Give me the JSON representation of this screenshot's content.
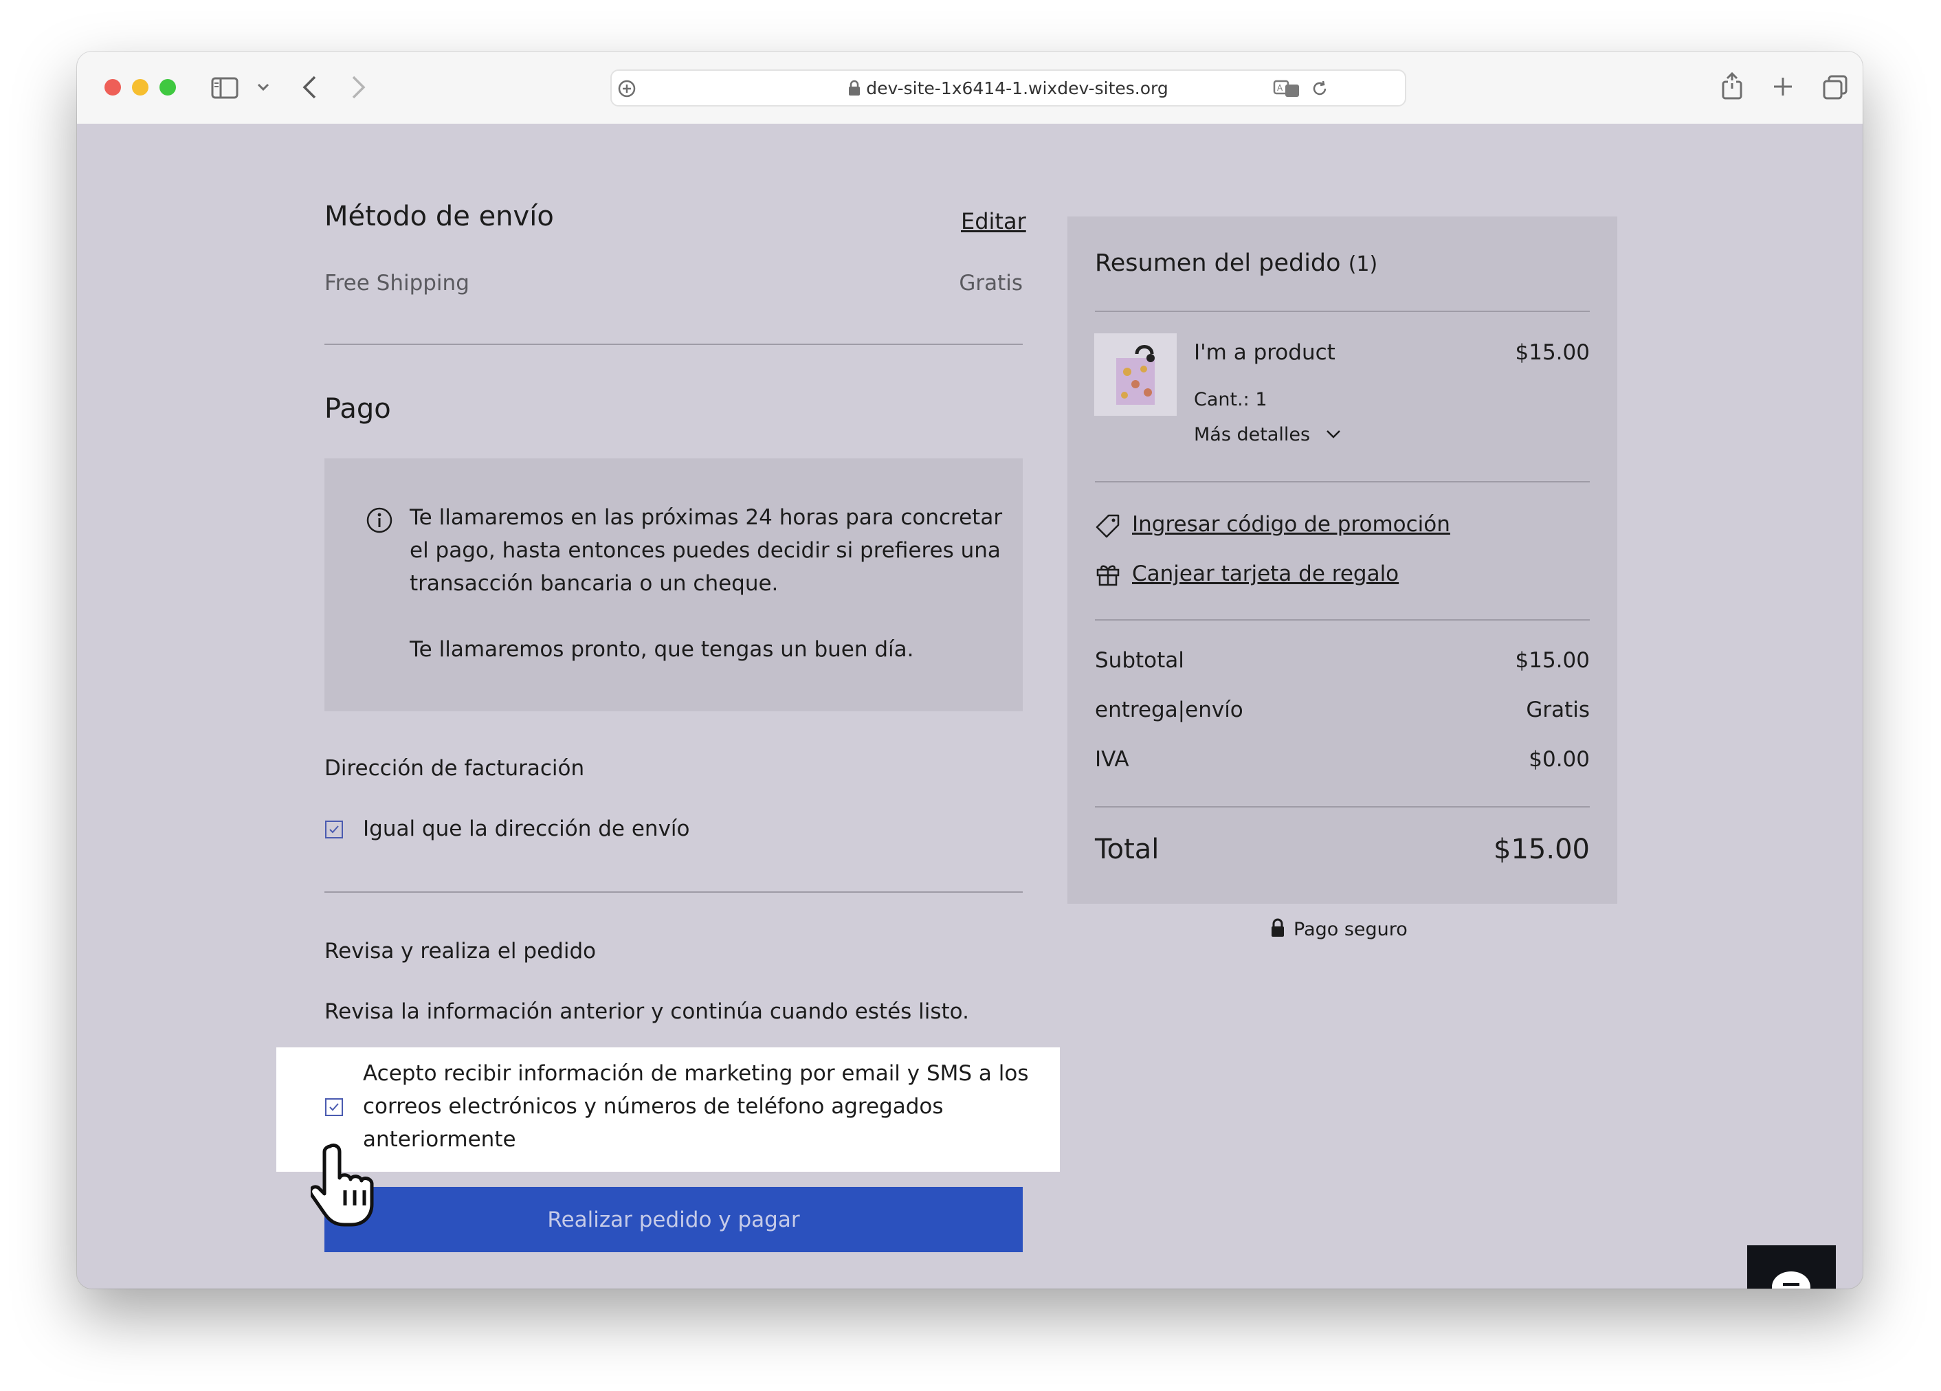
{
  "browser": {
    "url": "dev-site-1x6414-1.wixdev-sites.org"
  },
  "shipping": {
    "title": "Método de envío",
    "edit_label": "Editar",
    "method": "Free Shipping",
    "price": "Gratis"
  },
  "payment": {
    "title": "Pago",
    "info_line1": "Te llamaremos en las próximas 24 horas para concretar",
    "info_line2": "el pago, hasta entonces puedes decidir si prefieres una",
    "info_line3": "transacción bancaria o un cheque.",
    "info_line4": "Te llamaremos pronto, que tengas un buen día."
  },
  "billing": {
    "title": "Dirección de facturación",
    "same_as_shipping": "Igual que la dirección de envío",
    "same_checked": true
  },
  "review": {
    "title": "Revisa y realiza el pedido",
    "description": "Revisa la información anterior y continúa cuando estés listo.",
    "marketing_line1": "Acepto recibir información de marketing por email y SMS a los",
    "marketing_line2": "correos electrónicos y números de teléfono agregados",
    "marketing_line3": "anteriormente",
    "marketing_checked": true,
    "submit_label": "Realizar pedido y pagar"
  },
  "summary": {
    "title": "Resumen del pedido",
    "count": "(1)",
    "item": {
      "name": "I'm a product",
      "price": "$15.00",
      "quantity": "Cant.: 1",
      "more_details": "Más detalles"
    },
    "promo_link": "Ingresar código de promoción",
    "gift_link": "Canjear tarjeta de regalo",
    "subtotal_label": "Subtotal",
    "subtotal_value": "$15.00",
    "shipping_label": "entrega|envío",
    "shipping_value": "Gratis",
    "tax_label": "IVA",
    "tax_value": "$0.00",
    "total_label": "Total",
    "total_value": "$15.00",
    "secure_label": "Pago seguro"
  },
  "colors": {
    "page_bg": "#d0cdd8",
    "panel_bg": "#c3c0cb",
    "primary": "#2b51be",
    "chat_bg": "#111318"
  }
}
